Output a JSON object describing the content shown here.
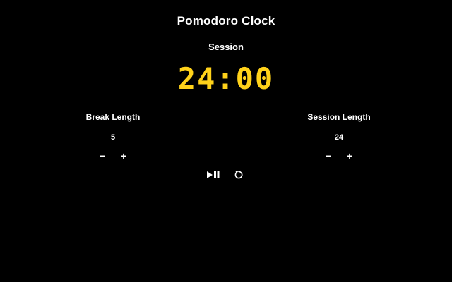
{
  "app": {
    "title": "Pomodoro Clock"
  },
  "timer": {
    "label": "Session",
    "display": "24:00",
    "color": "#ffd21a"
  },
  "break_control": {
    "label": "Break Length",
    "value": "5",
    "decrement": "−",
    "increment": "+"
  },
  "session_control": {
    "label": "Session Length",
    "value": "24",
    "decrement": "−",
    "increment": "+"
  },
  "transport": {
    "play_pause_icon": "play-pause-icon",
    "reset_icon": "reset-icon"
  }
}
